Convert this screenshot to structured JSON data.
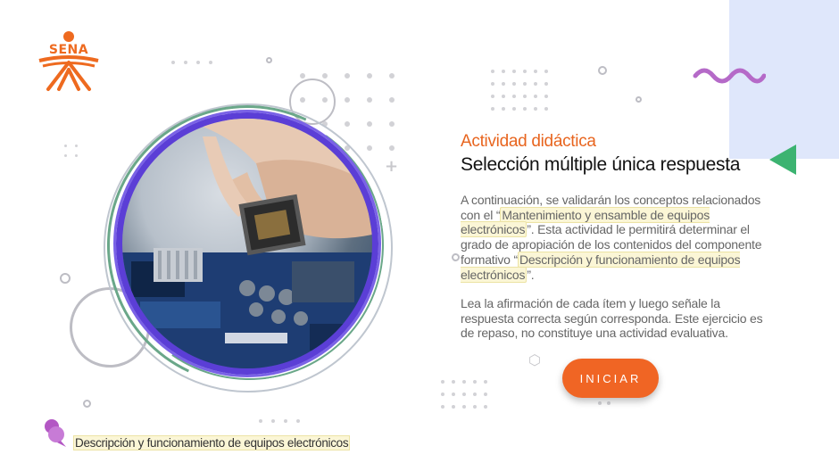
{
  "logo": {
    "text": "SENA"
  },
  "activity": {
    "subtitle": "Actividad didáctica",
    "title": "Selección múltiple única respuesta"
  },
  "intro": {
    "part1": "A continuación, se validarán los conceptos relacionados con el “",
    "highlight1": "Mantenimiento y ensamble de equipos electrónicos",
    "part2": "”.  Esta actividad le permitirá determinar el grado de apropiación de los contenidos del componente formativo “",
    "highlight2": "Descripción y funcionamiento de equipos electrónicos",
    "part3": "”."
  },
  "instructions": "Lea la afirmación de cada ítem y luego señale la respuesta correcta según corresponda.  Este ejercicio es de repaso, no constituye una actividad evaluativa.",
  "start_button": "INICIAR",
  "footer": {
    "component_name": "Descripción y funcionamiento de equipos electrónicos"
  },
  "icons": {
    "logo": "sena-logo-icon",
    "wave": "wave-icon",
    "triangle": "triangle-icon",
    "photo": "cpu-motherboard-photo",
    "footer": "chat-bubble-icon"
  },
  "colors": {
    "accent": "#f06524",
    "title": "#111111",
    "purple_ring": "#5b3ed6",
    "green": "#3cb371",
    "panel": "#dfe7fb",
    "highlight": "#fbf6d6"
  }
}
